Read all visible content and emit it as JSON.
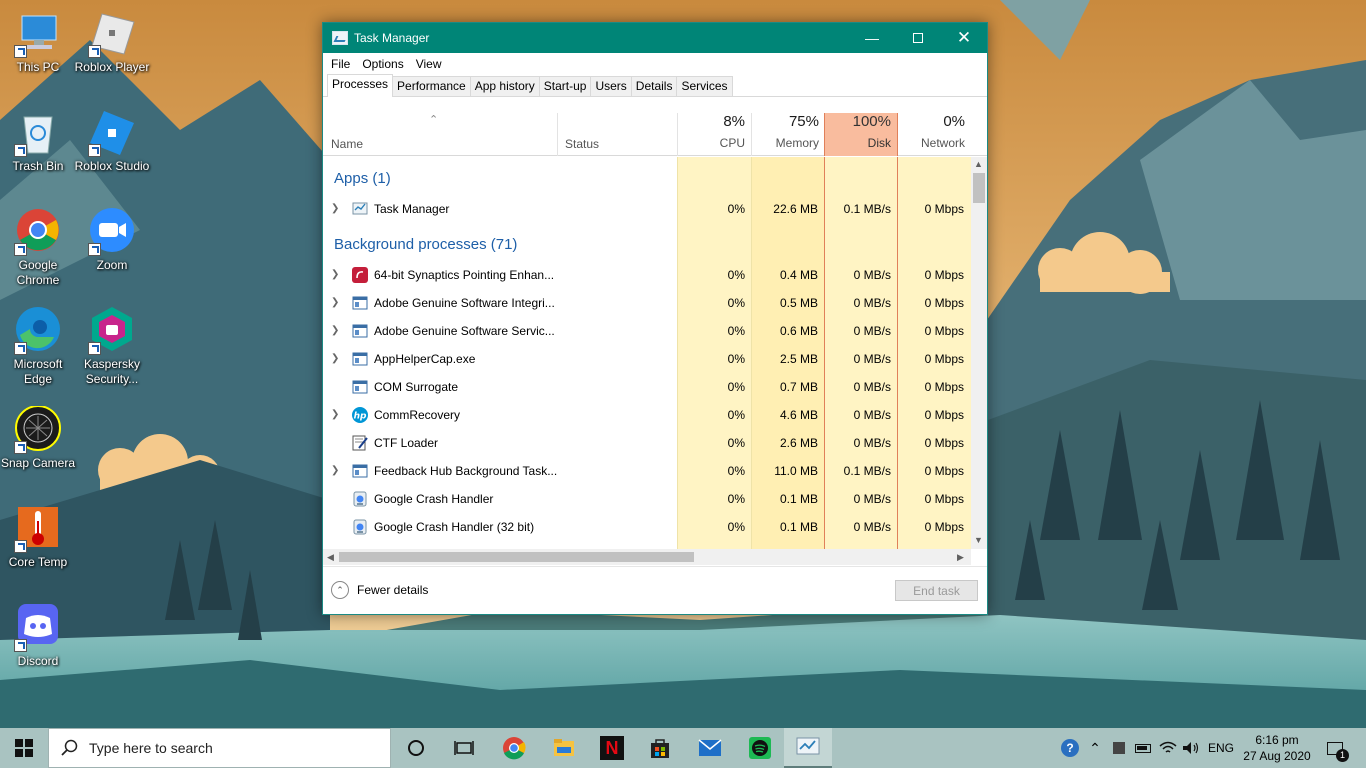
{
  "desktop": {
    "icons": [
      {
        "label": "This PC",
        "icon": "computer-icon"
      },
      {
        "label": "Roblox Player",
        "icon": "roblox-icon"
      },
      {
        "label": "Trash Bin",
        "icon": "recycle-bin-icon"
      },
      {
        "label": "Roblox Studio",
        "icon": "roblox-studio-icon"
      },
      {
        "label": "Google Chrome",
        "icon": "chrome-icon"
      },
      {
        "label": "Zoom",
        "icon": "zoom-icon"
      },
      {
        "label": "Microsoft Edge",
        "icon": "edge-icon"
      },
      {
        "label": "Kaspersky Security...",
        "icon": "kaspersky-icon"
      },
      {
        "label": "Snap Camera",
        "icon": "snap-camera-icon"
      },
      {
        "label": "Core Temp",
        "icon": "thermometer-icon"
      },
      {
        "label": "Discord",
        "icon": "discord-icon"
      }
    ]
  },
  "window": {
    "title": "Task Manager",
    "accent": "#008577",
    "menu": [
      "File",
      "Options",
      "View"
    ],
    "tabs": [
      "Processes",
      "Performance",
      "App history",
      "Start-up",
      "Users",
      "Details",
      "Services"
    ],
    "active_tab": "Processes",
    "columns": {
      "name": "Name",
      "status": "Status",
      "cpu": {
        "pct": "8%",
        "label": "CPU"
      },
      "memory": {
        "pct": "75%",
        "label": "Memory"
      },
      "disk": {
        "pct": "100%",
        "label": "Disk"
      },
      "network": {
        "pct": "0%",
        "label": "Network"
      }
    },
    "groups": {
      "apps": "Apps (1)",
      "background": "Background processes (71)"
    },
    "apps": [
      {
        "name": "Task Manager",
        "cpu": "0%",
        "memory": "22.6 MB",
        "disk": "0.1 MB/s",
        "network": "0 Mbps",
        "expand": true,
        "icon": "task-manager-icon"
      }
    ],
    "processes": [
      {
        "name": "64-bit Synaptics Pointing Enhan...",
        "cpu": "0%",
        "memory": "0.4 MB",
        "disk": "0 MB/s",
        "network": "0 Mbps",
        "expand": true,
        "icon": "synaptics-icon"
      },
      {
        "name": "Adobe Genuine Software Integri...",
        "cpu": "0%",
        "memory": "0.5 MB",
        "disk": "0 MB/s",
        "network": "0 Mbps",
        "expand": true,
        "icon": "service-window-icon"
      },
      {
        "name": "Adobe Genuine Software Servic...",
        "cpu": "0%",
        "memory": "0.6 MB",
        "disk": "0 MB/s",
        "network": "0 Mbps",
        "expand": true,
        "icon": "service-window-icon"
      },
      {
        "name": "AppHelperCap.exe",
        "cpu": "0%",
        "memory": "2.5 MB",
        "disk": "0 MB/s",
        "network": "0 Mbps",
        "expand": true,
        "icon": "service-window-icon"
      },
      {
        "name": "COM Surrogate",
        "cpu": "0%",
        "memory": "0.7 MB",
        "disk": "0 MB/s",
        "network": "0 Mbps",
        "expand": false,
        "icon": "service-window-icon"
      },
      {
        "name": "CommRecovery",
        "cpu": "0%",
        "memory": "4.6 MB",
        "disk": "0 MB/s",
        "network": "0 Mbps",
        "expand": true,
        "icon": "hp-icon"
      },
      {
        "name": "CTF Loader",
        "cpu": "0%",
        "memory": "2.6 MB",
        "disk": "0 MB/s",
        "network": "0 Mbps",
        "expand": false,
        "icon": "ctf-loader-icon"
      },
      {
        "name": "Feedback Hub Background Task...",
        "cpu": "0%",
        "memory": "11.0 MB",
        "disk": "0.1 MB/s",
        "network": "0 Mbps",
        "expand": true,
        "icon": "service-window-icon"
      },
      {
        "name": "Google Crash Handler",
        "cpu": "0%",
        "memory": "0.1 MB",
        "disk": "0 MB/s",
        "network": "0 Mbps",
        "expand": false,
        "icon": "google-update-icon"
      },
      {
        "name": "Google Crash Handler (32 bit)",
        "cpu": "0%",
        "memory": "0.1 MB",
        "disk": "0 MB/s",
        "network": "0 Mbps",
        "expand": false,
        "icon": "google-update-icon"
      }
    ],
    "footer": {
      "fewer_details": "Fewer details",
      "end_task": "End task"
    }
  },
  "taskbar": {
    "search_placeholder": "Type here to search",
    "language": "ENG",
    "time": "6:16 pm",
    "date": "27 Aug 2020",
    "notification_count": "1"
  }
}
